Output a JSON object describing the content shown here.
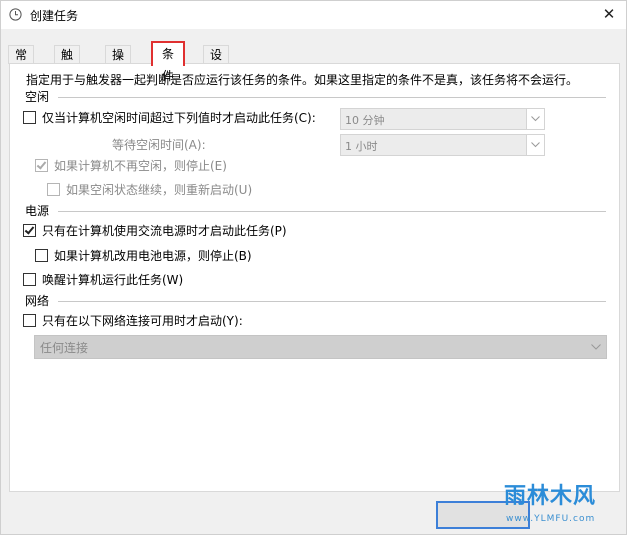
{
  "window": {
    "title": "创建任务",
    "close_label": "✕"
  },
  "tabs": [
    {
      "label": "常规",
      "active": false
    },
    {
      "label": "触发器",
      "active": false
    },
    {
      "label": "操作",
      "active": false
    },
    {
      "label": "条件",
      "active": true
    },
    {
      "label": "设置",
      "active": false
    }
  ],
  "conditions": {
    "description": "指定用于与触发器一起判断是否应运行该任务的条件。如果这里指定的条件不是真，该任务将不会运行。",
    "idle": {
      "section_label": "空闲",
      "start_only_if_idle": {
        "label": "仅当计算机空闲时间超过下列值时才启动此任务(C):",
        "checked": false
      },
      "idle_duration_value": "10 分钟",
      "wait_label": "等待空闲时间(A):",
      "wait_value": "1 小时",
      "stop_if_not_idle": {
        "label": "如果计算机不再空闲，则停止(E)",
        "checked": true
      },
      "restart_if_idle_resumes": {
        "label": "如果空闲状态继续，则重新启动(U)",
        "checked": false
      }
    },
    "power": {
      "section_label": "电源",
      "ac_only": {
        "label": "只有在计算机使用交流电源时才启动此任务(P)",
        "checked": true
      },
      "stop_on_battery": {
        "label": "如果计算机改用电池电源，则停止(B)",
        "checked": false
      },
      "wake_to_run": {
        "label": "唤醒计算机运行此任务(W)",
        "checked": false
      }
    },
    "network": {
      "section_label": "网络",
      "start_only_if_network": {
        "label": "只有在以下网络连接可用时才启动(Y):",
        "checked": false
      },
      "connection_value": "任何连接"
    }
  },
  "watermark": {
    "text": "雨林木风",
    "url": "www.YLMFU.com",
    "brand_color": "#2b8cd8"
  },
  "colors": {
    "active_tab_border": "#e03030",
    "default_button_border": "#3c7fd8"
  }
}
